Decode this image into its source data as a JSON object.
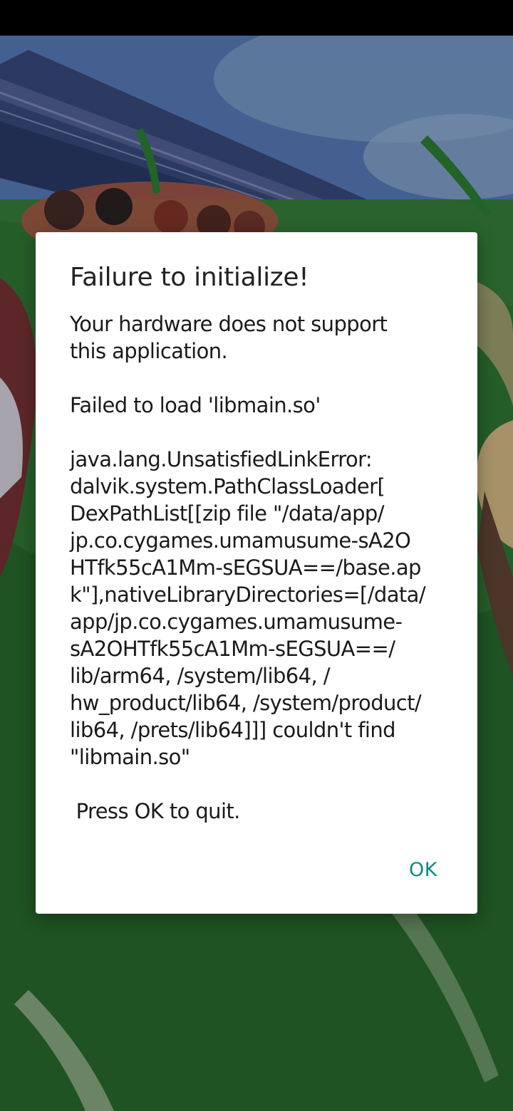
{
  "dialog": {
    "title": "Failure to initialize!",
    "message": "Your hardware does not support\nthis application.\n\nFailed to load 'libmain.so'\n\njava.lang.UnsatisfiedLinkError:\ndalvik.system.PathClassLoader[\nDexPathList[[zip file \"/data/app/\njp.co.cygames.umamusume-sA2O\nHTfk55cA1Mm-sEGSUA==/base.ap\nk\"],nativeLibraryDirectories=[/data/\napp/jp.co.cygames.umamusume-\nsA2OHTfk55cA1Mm-sEGSUA==/\nlib/arm64, /system/lib64, /\nhw_product/lib64, /system/product/\nlib64, /prets/lib64]]] couldn't find\n\"libmain.so\"\n\n Press OK to quit.",
    "ok_label": "OK"
  },
  "colors": {
    "status_bar": "#000000",
    "dialog_background": "#ffffff",
    "accent": "#0e8a84",
    "title_text": "#222222"
  }
}
